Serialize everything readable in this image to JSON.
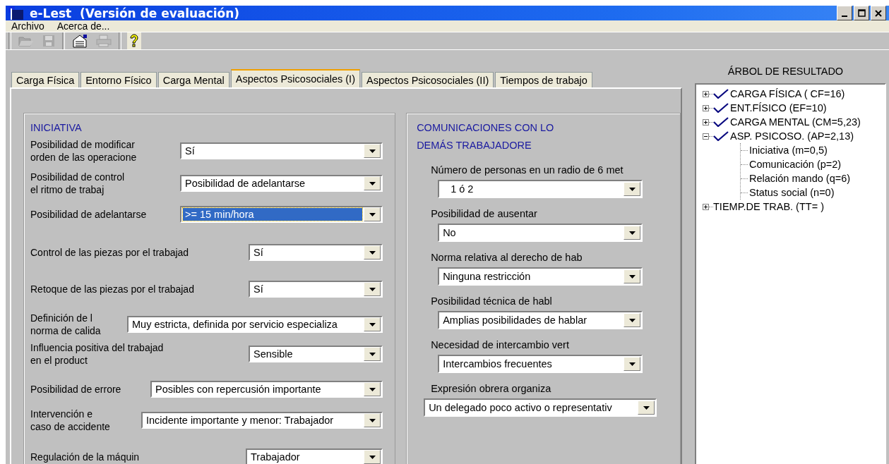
{
  "window": {
    "title": "e-Lest  (Versión de evaluación)"
  },
  "menu": [
    "Archivo",
    "Acerca de..."
  ],
  "toolbar": [
    {
      "kind": "open",
      "disabled": true
    },
    {
      "kind": "save",
      "disabled": true
    },
    {
      "kind": "properties",
      "disabled": false
    },
    {
      "kind": "print",
      "disabled": true
    },
    {
      "kind": "help",
      "disabled": false
    }
  ],
  "tabs": [
    {
      "label": "Carga Física",
      "selected": false
    },
    {
      "label": "Entorno Físico",
      "selected": false
    },
    {
      "label": "Carga Mental",
      "selected": false
    },
    {
      "label": "Aspectos Psicosociales (I)",
      "selected": true
    },
    {
      "label": "Aspectos Psicosociales (II)",
      "selected": false
    },
    {
      "label": "Tiempos de trabajo",
      "selected": false
    }
  ],
  "iniciativa": {
    "heading": "INICIATIVA",
    "rows": [
      {
        "label": [
          "Posibilidad de modificar",
          "orden de las operacione"
        ],
        "value": "Sí",
        "focused": false
      },
      {
        "label": [
          "Posibilidad de control",
          "el ritmo de trabaj"
        ],
        "value": "Posibilidad de adelantarse",
        "focused": false
      },
      {
        "label": [
          "Posibilidad de adelantarse"
        ],
        "value": ">= 15 min/hora",
        "focused": true
      },
      {
        "label": [
          "Control de las piezas por el trabajad"
        ],
        "value": "Sí",
        "focused": false
      },
      {
        "label": [
          "Retoque de las piezas por el trabajad"
        ],
        "value": "Sí",
        "focused": false
      },
      {
        "label": [
          "Definición de l",
          "norma de calida"
        ],
        "value": "Muy estricta, definida por servicio especializa",
        "focused": false
      },
      {
        "label": [
          "Influencia positiva del trabajad",
          "en el product"
        ],
        "value": "Sensible",
        "focused": false
      },
      {
        "label": [
          "Posibilidad de errore"
        ],
        "value": "Posibles con repercusión importante",
        "focused": false
      },
      {
        "label": [
          "Intervención e",
          "caso de accidente"
        ],
        "value": "Incidente importante y menor: Trabajador",
        "focused": false
      },
      {
        "label": [
          "Regulación de la máquin"
        ],
        "value": "Trabajador",
        "focused": false
      }
    ]
  },
  "comunicaciones": {
    "heading": [
      "COMUNICACIONES CON LO",
      "DEMÁS TRABAJADORE"
    ],
    "rows": [
      {
        "label": "Número de personas en un radio de 6 met",
        "value": "1 ó 2",
        "focused": false
      },
      {
        "label": "Posibilidad de ausentar",
        "value": "No",
        "focused": false
      },
      {
        "label": "Norma relativa al derecho de hab",
        "value": "Ninguna restricción",
        "focused": false
      },
      {
        "label": "Posibilidad técnica de habl",
        "value": "Amplias posibilidades de hablar",
        "focused": false
      },
      {
        "label": "Necesidad de intercambio vert",
        "value": "Intercambios frecuentes",
        "focused": false
      },
      {
        "label": "Expresión obrera organiza",
        "value": "Un delegado poco activo o representativ",
        "focused": false
      }
    ]
  },
  "results_tree": {
    "heading": "ÁRBOL DE RESULTADO",
    "items": [
      {
        "label": "CARGA FÍSICA ( CF=16)",
        "checked": true,
        "expanded": false
      },
      {
        "label": "ENT.FÍSICO (EF=10)",
        "checked": true,
        "expanded": false
      },
      {
        "label": "CARGA MENTAL (CM=5,23)",
        "checked": true,
        "expanded": false
      },
      {
        "label": "ASP. PSICOSO. (AP=2,13)",
        "checked": true,
        "expanded": true,
        "children": [
          {
            "label": "Iniciativa (m=0,5)"
          },
          {
            "label": "Comunicación (p=2)"
          },
          {
            "label": "Relación mando (q=6)"
          },
          {
            "label": "Status social (n=0)"
          }
        ]
      },
      {
        "label": "TIEMP.DE TRAB. (TT=  )",
        "checked": false,
        "expanded": false
      }
    ]
  }
}
